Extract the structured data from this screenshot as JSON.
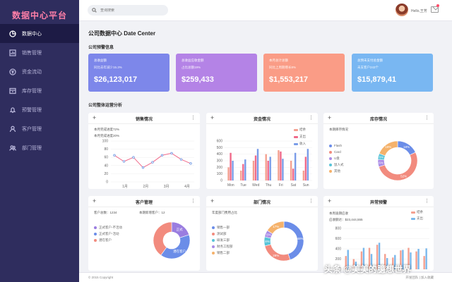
{
  "app": {
    "title": "数据中心平台"
  },
  "sidebar": {
    "items": [
      {
        "label": "数据中心",
        "icon": "pie-chart-icon"
      },
      {
        "label": "销售管理",
        "icon": "bar-chart-icon"
      },
      {
        "label": "资金流动",
        "icon": "currency-icon"
      },
      {
        "label": "库存管理",
        "icon": "inventory-icon"
      },
      {
        "label": "预警管理",
        "icon": "bell-icon"
      },
      {
        "label": "客户管理",
        "icon": "user-icon"
      },
      {
        "label": "部门管理",
        "icon": "users-icon"
      }
    ]
  },
  "topbar": {
    "search_placeholder": "查询搜索",
    "greeting": "Hello,王芳"
  },
  "page": {
    "title": "公司数据中心  Date Center",
    "alert_section": "公司预警信息",
    "analysis_section": "公司整体运营分析"
  },
  "colors": {
    "card1": "#7d87ea",
    "card2": "#b483e6",
    "card3": "#fa9c86",
    "card4": "#79b7f2",
    "pink": "#f06a8a",
    "blue": "#5a8ae0",
    "purple": "#9a7de0"
  },
  "cards": [
    {
      "line1": "总收益额",
      "line2": "同比去年减少15.3%",
      "value": "$26,123,017"
    },
    {
      "line1": "总收益应收金额",
      "line2": "占比总额19%",
      "value": "$259,433"
    },
    {
      "line1": "本月总计总额",
      "line2": "同比上周期增长8%",
      "value": "$1,553,217"
    },
    {
      "line1": "总预未支付总金额",
      "line2": "未支客户243个",
      "value": "$15,879,41"
    }
  ],
  "panels": {
    "sales": {
      "title": "销售情况",
      "note1": "本月完成进度72%",
      "note2": "本月完成进度20%"
    },
    "funds": {
      "title": "资金情况",
      "legend": [
        "结余",
        "支出",
        "收入"
      ]
    },
    "inventory": {
      "title": "库存情况",
      "note": "本期库存情况",
      "legend": [
        "Flash",
        "Card",
        "U盘",
        "鼠人式",
        "其他"
      ],
      "labels": [
        "18%",
        "52%",
        "6%",
        "5%",
        "19%"
      ]
    },
    "customers": {
      "title": "客户管理",
      "note_total": "客户总数：1234",
      "note_new": "本期新增客户：12",
      "legend": [
        "正式客户-不活动",
        "正式客户-活动",
        "潜在客户"
      ],
      "labels": [
        "正式",
        "潜在客户"
      ]
    },
    "departments": {
      "title": "部门情况",
      "note": "年度部门费用占比",
      "legend": [
        "销售一部",
        "测试部",
        "研发三部",
        "财务工程部",
        "销售二部"
      ],
      "labels": [
        "48%",
        "28%",
        "8%",
        "6%",
        "17%"
      ]
    },
    "warnings": {
      "title": "异常预警",
      "note1": "本周逾期应收",
      "note2": "应收额达：$23,444,555",
      "legend": [
        "结余",
        "支出"
      ]
    }
  },
  "chart_data": [
    {
      "type": "line",
      "title": "销售情况",
      "x": [
        "1月",
        "2月",
        "3月",
        "4月"
      ],
      "ylim": [
        0,
        100
      ],
      "yticks": [
        "100",
        "80",
        "60",
        "40",
        "20",
        "0"
      ],
      "series": [
        {
          "values": [
            65,
            50,
            60,
            35,
            48,
            65,
            70,
            55,
            45
          ]
        }
      ]
    },
    {
      "type": "bar",
      "title": "资金情况",
      "categories": [
        "Mon",
        "Tue",
        "Wed",
        "Thu",
        "Fri",
        "Sat",
        "Sun"
      ],
      "ylim": [
        0,
        600
      ],
      "yticks": [
        "600",
        "500",
        "400",
        "300",
        "200",
        "100",
        "0"
      ],
      "series": [
        {
          "name": "结余",
          "values": [
            200,
            150,
            300,
            400,
            460,
            300,
            150
          ]
        },
        {
          "name": "支出",
          "values": [
            420,
            250,
            380,
            300,
            440,
            180,
            360
          ]
        },
        {
          "name": "收入",
          "values": [
            300,
            320,
            480,
            360,
            330,
            420,
            480
          ]
        }
      ]
    },
    {
      "type": "pie",
      "title": "库存情况",
      "labels": [
        "Flash",
        "Card",
        "U盘",
        "鼠人式",
        "其他"
      ],
      "values": [
        18,
        52,
        6,
        5,
        19
      ]
    },
    {
      "type": "pie",
      "title": "客户管理",
      "labels": [
        "正式客户-不活动",
        "正式客户-活动",
        "潜在客户"
      ],
      "values": [
        20,
        40,
        40
      ]
    },
    {
      "type": "pie",
      "title": "部门情况",
      "labels": [
        "销售一部",
        "测试部",
        "研发三部",
        "财务工程部",
        "销售二部"
      ],
      "values": [
        48,
        28,
        8,
        6,
        17
      ]
    },
    {
      "type": "bar",
      "title": "异常预警",
      "categories": [
        "1",
        "2",
        "3",
        "4",
        "5",
        "6",
        "7",
        "8",
        "9",
        "10",
        "11"
      ],
      "ylim": [
        0,
        800
      ],
      "yticks": [
        "800",
        "600",
        "400",
        "200",
        "0"
      ],
      "series": [
        {
          "name": "结余",
          "values": [
            260,
            200,
            350,
            420,
            480,
            300,
            230,
            370,
            420,
            350,
            260
          ]
        },
        {
          "name": "支出",
          "values": [
            380,
            150,
            420,
            300,
            520,
            220,
            280,
            380,
            330,
            400,
            410
          ]
        }
      ]
    }
  ],
  "footer": {
    "copyright": "© 2015 Copyright",
    "links": "开发团队 | 加入收藏"
  },
  "watermark": "头条 @美美的臆想世界"
}
